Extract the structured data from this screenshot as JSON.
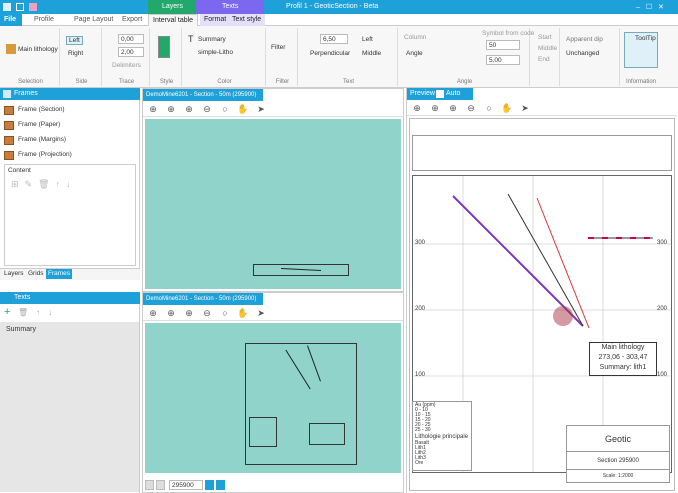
{
  "window": {
    "title": "Profil 1 - GeoticSection - Beta",
    "layers_tab": "Layers",
    "texts_tab": "Texts",
    "controls": "– ☐ ✕"
  },
  "ribbon_tabs": [
    "File",
    "Profile",
    "Page Layout",
    "Export",
    "Interval table",
    "Format",
    "Text style"
  ],
  "ribbon": {
    "main_lithology": "Main lithology",
    "left": "Left",
    "right": "Right",
    "trace_v1": "0,00",
    "trace_v2": "2,00",
    "delimiters": "Delimiters",
    "summary": "Summary",
    "simple_litho": "simple-Litho",
    "filter": "Filter",
    "text_value": "6,50",
    "align_left": "Left",
    "perpendicular": "Perpendicular",
    "middle": "Middle",
    "column": "Column",
    "angle": "Angle",
    "symbol_from_code": "Symbol from code",
    "angle_value": "50",
    "angle_value2": "5,00",
    "start": "Start",
    "middle2": "Middle",
    "end": "End",
    "apparent_dip": "Apparent dip",
    "unchanged": "Unchanged",
    "tooltip": "ToolTip",
    "groups": [
      "Selection",
      "Side",
      "Trace",
      "Style",
      "Color",
      "Filter",
      "Text",
      "Angle",
      "Information"
    ]
  },
  "frames_panel": {
    "title": "Frames",
    "items": [
      "Frame (Section)",
      "Frame (Paper)",
      "Frame (Margins)",
      "Frame (Projection)"
    ],
    "content_label": "Content",
    "tabs": [
      "Layers",
      "Grids",
      "Frames"
    ]
  },
  "texts_panel": {
    "title": "Texts",
    "items": [
      "Summary"
    ]
  },
  "views": {
    "top_title": "DemoMine6201 - Section - 50m (295900)",
    "bottom_title": "DemoMine6201 - Section - 50m (295900)",
    "page_value": "295900"
  },
  "preview": {
    "title": "Preview",
    "auto": "Auto",
    "tooltip": [
      "Main lithology",
      "273,06 - 303,47",
      "Summary: lith1"
    ],
    "axis_labels": [
      "300",
      "200",
      "100"
    ],
    "legend_au": [
      "Au (ppm)",
      "0 - 10",
      "10 - 15",
      "15 - 20",
      "20 - 25",
      "25 - 30"
    ],
    "legend_litho": [
      "Lithologie principale",
      "Basalt",
      "Lith1",
      "Lith2",
      "Lith3",
      "Ore"
    ],
    "cartouche": {
      "logo": "Geotic",
      "section": "Section 295900",
      "scale": "Scale: 1:2000"
    }
  },
  "colors": {
    "accent": "#1ea0d8",
    "teal": "#8fd3cb",
    "layers_tab_bg": "#23a86b",
    "texts_tab_bg": "#7b68ee"
  }
}
